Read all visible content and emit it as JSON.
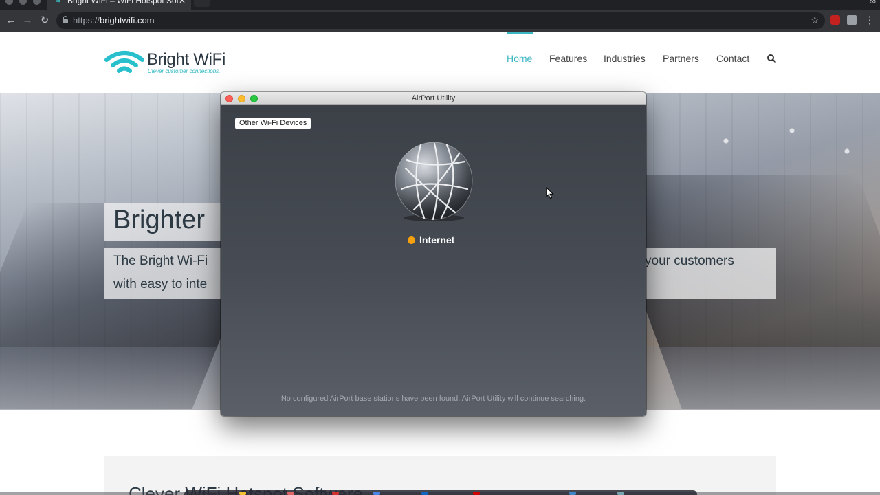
{
  "browser": {
    "tab_title": "Bright WiFi – WiFi Hotspot Sol",
    "tab_close": "✕",
    "tab_extra": "∞",
    "url_scheme": "https://",
    "url_host": "brightwifi.com"
  },
  "site": {
    "logo_name": "Bright WiFi",
    "logo_tagline": "Clever customer connections.",
    "nav": [
      "Home",
      "Features",
      "Industries",
      "Partners",
      "Contact"
    ],
    "hero_title": "Brighter",
    "hero_sub_line1": "The Bright Wi-Fi",
    "hero_sub_line2": "with easy to inte",
    "hero_sub_right": "your customers",
    "section_heading": "Clever WiFi Hotspot Software"
  },
  "airport": {
    "window_title": "AirPort Utility",
    "other_devices": "Other Wi-Fi Devices",
    "internet_label": "Internet",
    "status_message": "No configured AirPort base stations have been found. AirPort Utility will continue searching."
  },
  "colors": {
    "accent": "#3bb6c3",
    "status_orange": "#f5a00f"
  }
}
